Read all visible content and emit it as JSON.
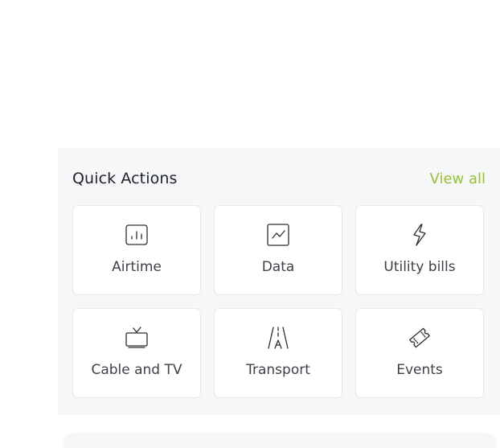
{
  "quick_actions": {
    "title": "Quick Actions",
    "view_all_label": "View all",
    "accent_color": "#97c135",
    "items": [
      {
        "label": "Airtime",
        "icon": "airtime-icon"
      },
      {
        "label": "Data",
        "icon": "data-chart-icon"
      },
      {
        "label": "Utility bills",
        "icon": "lightning-icon"
      },
      {
        "label": "Cable and TV",
        "icon": "tv-icon"
      },
      {
        "label": "Transport",
        "icon": "road-icon"
      },
      {
        "label": "Events",
        "icon": "ticket-icon"
      }
    ]
  }
}
